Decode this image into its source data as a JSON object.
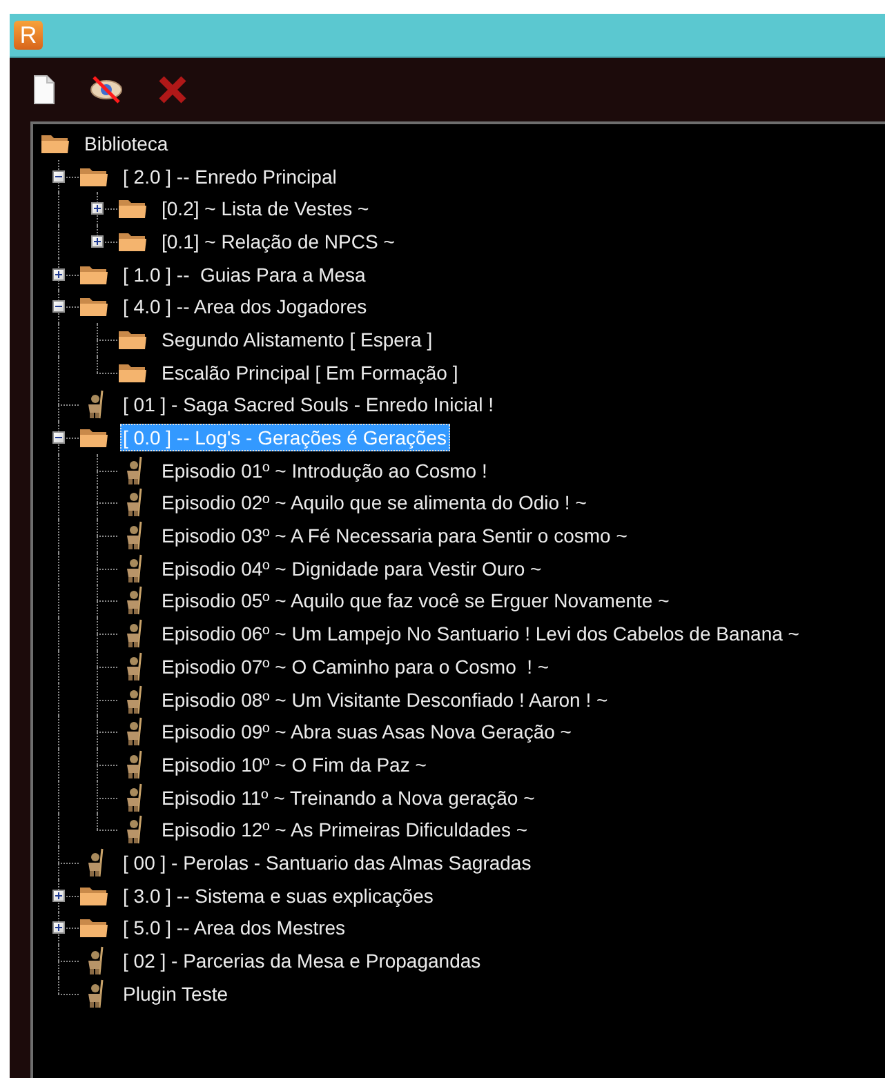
{
  "window": {
    "app_icon_letter": "R"
  },
  "tree": {
    "label": "Biblioteca",
    "kind": "folder",
    "selected": false,
    "children": [
      {
        "label": "[ 2.0 ] -- Enredo Principal",
        "kind": "folder",
        "selected": false,
        "expanded": true,
        "children": [
          {
            "label": "[0.2] ~ Lista de Vestes ~",
            "kind": "folder",
            "selected": false,
            "expanded": false
          },
          {
            "label": "[0.1] ~ Relação de NPCS ~",
            "kind": "folder",
            "selected": false,
            "expanded": false
          }
        ]
      },
      {
        "label": "[ 1.0 ] --  Guias Para a Mesa",
        "kind": "folder",
        "selected": false,
        "expanded": false
      },
      {
        "label": "[ 4.0 ] -- Area dos Jogadores",
        "kind": "folder",
        "selected": false,
        "expanded": true,
        "children": [
          {
            "label": "Segundo Alistamento [ Espera ]",
            "kind": "folder",
            "selected": false
          },
          {
            "label": "Escalão Principal [ Em Formação ]",
            "kind": "folder",
            "selected": false
          }
        ]
      },
      {
        "label": "[ 01 ] - Saga Sacred Souls - Enredo Inicial !",
        "kind": "character",
        "selected": false
      },
      {
        "label": "[ 0.0 ] -- Log's - Gerações é Gerações",
        "kind": "folder",
        "selected": true,
        "expanded": true,
        "children": [
          {
            "label": "Episodio 01º ~ Introdução ao Cosmo !",
            "kind": "character",
            "selected": false
          },
          {
            "label": "Episodio 02º ~ Aquilo que se alimenta do Odio ! ~",
            "kind": "character",
            "selected": false
          },
          {
            "label": "Episodio 03º ~ A Fé Necessaria para Sentir o cosmo ~",
            "kind": "character",
            "selected": false
          },
          {
            "label": "Episodio 04º ~ Dignidade para Vestir Ouro ~",
            "kind": "character",
            "selected": false
          },
          {
            "label": "Episodio 05º ~ Aquilo que faz você se Erguer Novamente ~",
            "kind": "character",
            "selected": false
          },
          {
            "label": "Episodio 06º ~ Um Lampejo No Santuario ! Levi dos Cabelos de Banana ~",
            "kind": "character",
            "selected": false
          },
          {
            "label": "Episodio 07º ~ O Caminho para o Cosmo  ! ~",
            "kind": "character",
            "selected": false
          },
          {
            "label": "Episodio 08º ~ Um Visitante Desconfiado ! Aaron ! ~",
            "kind": "character",
            "selected": false
          },
          {
            "label": "Episodio 09º ~ Abra suas Asas Nova Geração ~",
            "kind": "character",
            "selected": false
          },
          {
            "label": "Episodio 10º ~ O Fim da Paz ~",
            "kind": "character",
            "selected": false
          },
          {
            "label": "Episodio 11º ~ Treinando a Nova geração ~",
            "kind": "character",
            "selected": false
          },
          {
            "label": "Episodio 12º ~ As Primeiras Dificuldades ~",
            "kind": "character",
            "selected": false
          }
        ]
      },
      {
        "label": "[ 00 ] - Perolas - Santuario das Almas Sagradas",
        "kind": "character",
        "selected": false
      },
      {
        "label": "[ 3.0 ] -- Sistema e suas explicações",
        "kind": "folder",
        "selected": false,
        "expanded": false
      },
      {
        "label": "[ 5.0 ] -- Area dos Mestres",
        "kind": "folder",
        "selected": false,
        "expanded": false
      },
      {
        "label": "[ 02 ] - Parcerias da Mesa e Propagandas",
        "kind": "character",
        "selected": false
      },
      {
        "label": "Plugin Teste",
        "kind": "character",
        "selected": false
      }
    ]
  }
}
